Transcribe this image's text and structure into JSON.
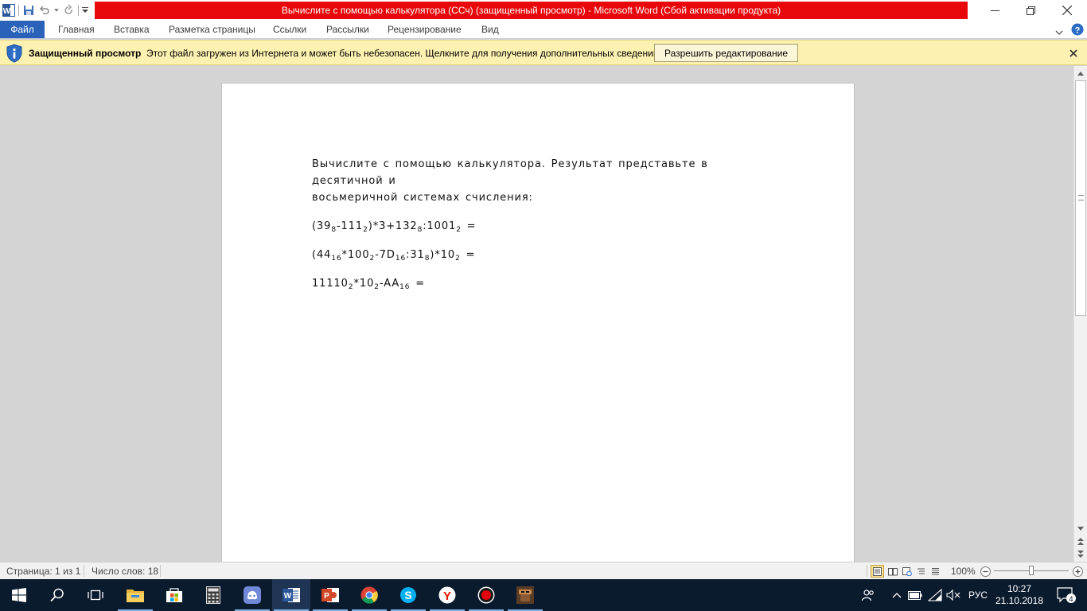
{
  "window": {
    "title": "Вычислите с помощью калькулятора (ССч) (защищенный просмотр)  -  Microsoft Word (Сбой активации продукта)",
    "accent_color": "#e8070a"
  },
  "ribbon": {
    "tabs": [
      "Файл",
      "Главная",
      "Вставка",
      "Разметка страницы",
      "Ссылки",
      "Рассылки",
      "Рецензирование",
      "Вид"
    ],
    "active_tab": "Файл"
  },
  "protected_view": {
    "title": "Защищенный просмотр",
    "message": "Этот файл загружен из Интернета и может быть небезопасен. Щелкните для получения дополнительных сведений.",
    "enable_button": "Разрешить редактирование"
  },
  "document": {
    "intro_line1": "Вычислите с помощью калькулятора. Результат представьте в десятичной и",
    "intro_line2": "восьмеричной системах счисления:",
    "expr1": {
      "a": "(39",
      "a_sub": "8",
      "b": "-111",
      "b_sub": "2",
      "c": ")*3+132",
      "c_sub": "8",
      "d": ":1001",
      "d_sub": "2",
      "tail": " ="
    },
    "expr2": {
      "a": "(44",
      "a_sub": "16",
      "b": "*100",
      "b_sub": "2",
      "c": "-7D",
      "c_sub": "16",
      "d": ":31",
      "d_sub": "8",
      "e": ")*10",
      "e_sub": "2",
      "tail": " ="
    },
    "expr3": {
      "a": "11110",
      "a_sub": "2",
      "b": "*10",
      "b_sub": "2",
      "c": "-AA",
      "c_sub": "16",
      "tail": " ="
    }
  },
  "statusbar": {
    "page": "Страница: 1 из 1",
    "words": "Число слов: 18",
    "zoom": "100%",
    "zoom_level_percent": 100
  },
  "taskbar": {
    "apps": [
      "start-icon",
      "search-icon",
      "task-view-icon",
      "file-explorer-icon",
      "store-icon",
      "calculator-icon",
      "discord-icon",
      "word-icon",
      "powerpoint-icon",
      "chrome-icon",
      "skype-icon",
      "yandex-icon",
      "record-icon",
      "game-icon"
    ],
    "language": "РУС",
    "time": "10:27",
    "date": "21.10.2018",
    "notifications": "4"
  }
}
